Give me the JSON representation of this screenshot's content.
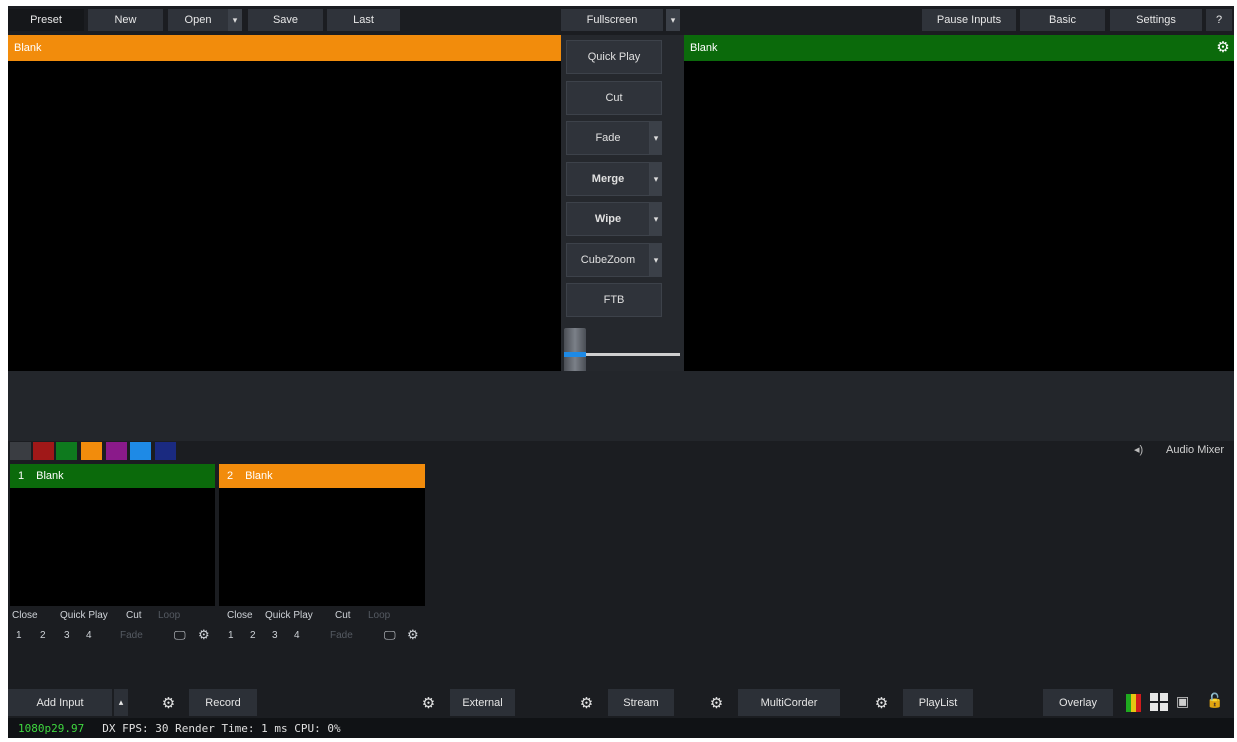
{
  "toolbar": {
    "preset": "Preset",
    "new": "New",
    "open": "Open",
    "save": "Save",
    "last": "Last",
    "fullscreen": "Fullscreen",
    "pause_inputs": "Pause Inputs",
    "basic": "Basic",
    "settings": "Settings",
    "help": "?"
  },
  "preview": {
    "title": "Blank",
    "color": "#f28c0c"
  },
  "output": {
    "title": "Blank",
    "color": "#0b6a0b"
  },
  "transitions": {
    "quick_play": "Quick Play",
    "cut": "Cut",
    "fade": "Fade",
    "merge": "Merge",
    "wipe": "Wipe",
    "cubezoom": "CubeZoom",
    "ftb": "FTB"
  },
  "color_swatches": [
    "#3a3d42",
    "#a01818",
    "#0e7a1e",
    "#f28c0c",
    "#8a1a8a",
    "#1e8ae6",
    "#1a2a80"
  ],
  "audio_mixer": {
    "label": "Audio Mixer"
  },
  "inputs": [
    {
      "number": "1",
      "title": "Blank",
      "color": "#0b6a0b",
      "close": "Close",
      "quick_play": "Quick Play",
      "cut": "Cut",
      "loop": "Loop",
      "overlays": [
        "1",
        "2",
        "3",
        "4"
      ],
      "fade": "Fade"
    },
    {
      "number": "2",
      "title": "Blank",
      "color": "#f28c0c",
      "close": "Close",
      "quick_play": "Quick Play",
      "cut": "Cut",
      "loop": "Loop",
      "overlays": [
        "1",
        "2",
        "3",
        "4"
      ],
      "fade": "Fade"
    }
  ],
  "bottom": {
    "add_input": "Add Input",
    "record": "Record",
    "external": "External",
    "stream": "Stream",
    "multicorder": "MultiCorder",
    "playlist": "PlayList",
    "overlay": "Overlay"
  },
  "status": {
    "format": "1080p29.97",
    "info": "DX FPS: 30 Render Time: 1 ms CPU: 0%"
  }
}
